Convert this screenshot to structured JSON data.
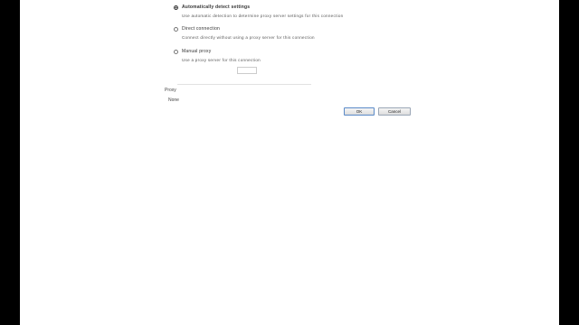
{
  "options": [
    {
      "title": "Automatically detect settings",
      "description": "Use automatic detection to determine proxy server settings for this connection",
      "selected": true
    },
    {
      "title": "Direct connection",
      "description": "Connect directly without using a proxy server for this connection",
      "selected": false
    },
    {
      "title": "Manual proxy",
      "description": "Use a proxy server for this connection",
      "selected": false
    }
  ],
  "proxy": {
    "label": "Proxy",
    "value": "None"
  },
  "buttons": {
    "ok": "OK",
    "cancel": "Cancel"
  }
}
